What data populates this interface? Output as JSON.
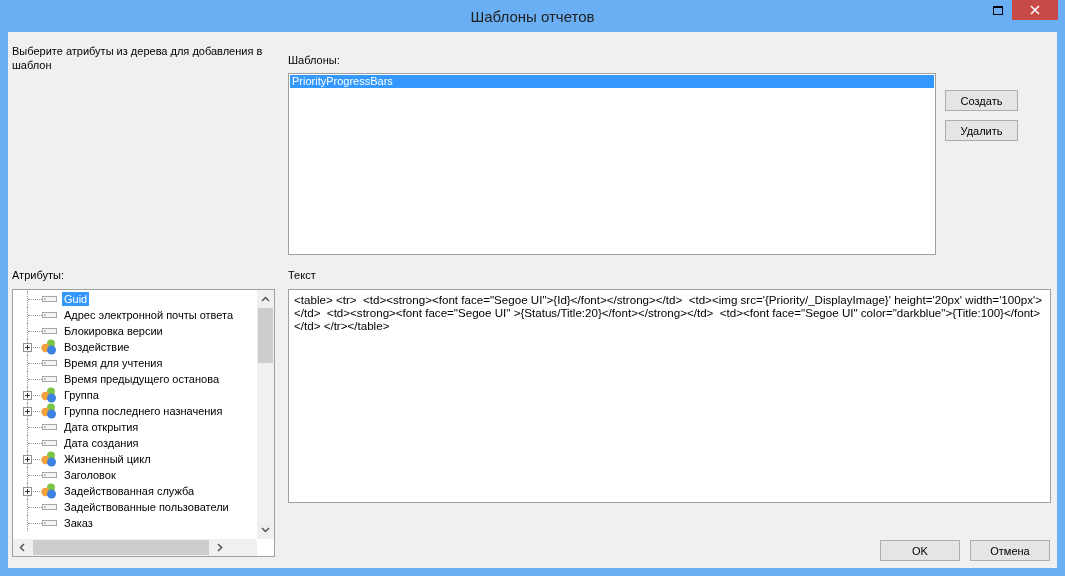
{
  "window": {
    "title": "Шаблоны отчетов"
  },
  "instruction": "Выберите атрибуты из дерева для добавления в шаблон",
  "templates": {
    "label": "Шаблоны:",
    "items": [
      {
        "label": "PriorityProgressBars",
        "selected": true
      }
    ]
  },
  "template_buttons": [
    "Создать",
    "Удалить"
  ],
  "attributes": {
    "label": "Атрибуты:",
    "items": [
      {
        "label": "Guid",
        "kind": "field",
        "selected": true
      },
      {
        "label": "Адрес электронной почты ответа",
        "kind": "field",
        "selected": false
      },
      {
        "label": "Блокировка версии",
        "kind": "field",
        "selected": false
      },
      {
        "label": "Воздействие",
        "kind": "group",
        "selected": false
      },
      {
        "label": "Время для учтения",
        "kind": "field",
        "selected": false
      },
      {
        "label": "Время предыдущего останова",
        "kind": "field",
        "selected": false
      },
      {
        "label": "Группа",
        "kind": "group",
        "selected": false
      },
      {
        "label": "Группа последнего назначения",
        "kind": "group",
        "selected": false
      },
      {
        "label": "Дата открытия",
        "kind": "field",
        "selected": false
      },
      {
        "label": "Дата создания",
        "kind": "field",
        "selected": false
      },
      {
        "label": "Жизненный цикл",
        "kind": "group",
        "selected": false
      },
      {
        "label": "Заголовок",
        "kind": "field",
        "selected": false
      },
      {
        "label": "Задействованная служба",
        "kind": "group",
        "selected": false
      },
      {
        "label": "Задействованные пользователи",
        "kind": "field",
        "selected": false
      },
      {
        "label": "Заказ",
        "kind": "field",
        "selected": false
      }
    ]
  },
  "text": {
    "label": "Текст",
    "value": "<table> <tr>  <td><strong><font face=\"Segoe UI\">{Id}</font></strong></td>  <td><img src='{Priority/_DisplayImage}' height='20px' width='100px'></td>  <td><strong><font face=\"Segoe UI\" >{Status/Title:20}</font></strong></td>  <td><font face=\"Segoe UI\" color=\"darkblue\">{Title:100}</font></td> </tr></table>"
  },
  "dialog_buttons": [
    "OK",
    "Отмена"
  ]
}
